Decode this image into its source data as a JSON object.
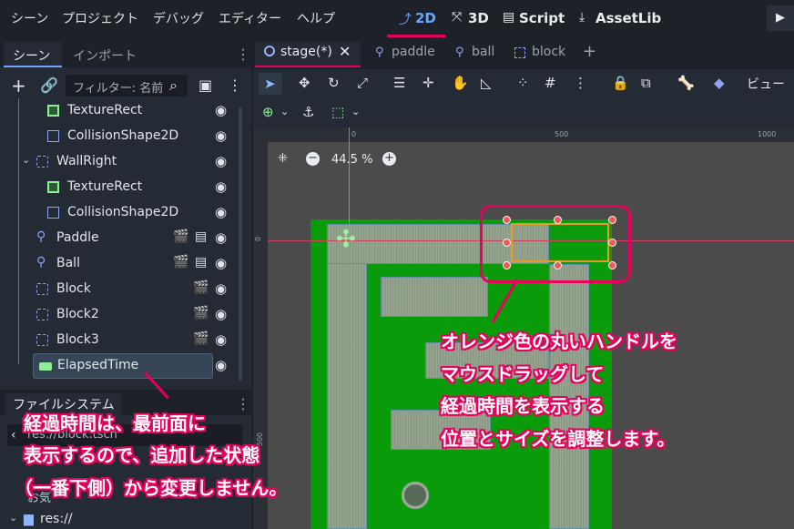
{
  "menubar": {
    "items": [
      "シーン",
      "プロジェクト",
      "デバッグ",
      "エディター",
      "ヘルプ"
    ],
    "workspaces": [
      {
        "label": "2D",
        "icon": "2d-workspace-icon",
        "active": true
      },
      {
        "label": "3D",
        "icon": "3d-workspace-icon",
        "active": false
      },
      {
        "label": "Script",
        "icon": "script-icon",
        "active": false
      },
      {
        "label": "AssetLib",
        "icon": "download-icon",
        "active": false
      }
    ],
    "play_icon": "▶"
  },
  "scene_dock": {
    "tabs": [
      "シーン",
      "インポート"
    ],
    "filter_placeholder": "フィルター: 名前",
    "tree": [
      {
        "label": "TextureRect",
        "icon": "texture-rect-icon"
      },
      {
        "label": "CollisionShape2D",
        "icon": "collision-shape-icon"
      },
      {
        "label": "WallRight",
        "icon": "node2d-icon",
        "expanded": true
      },
      {
        "label": "TextureRect",
        "icon": "texture-rect-icon"
      },
      {
        "label": "CollisionShape2D",
        "icon": "collision-shape-icon"
      },
      {
        "label": "Paddle",
        "icon": "character-body-icon"
      },
      {
        "label": "Ball",
        "icon": "character-body-icon"
      },
      {
        "label": "Block",
        "icon": "node2d-icon"
      },
      {
        "label": "Block2",
        "icon": "node2d-icon"
      },
      {
        "label": "Block3",
        "icon": "node2d-icon"
      },
      {
        "label": "ElapsedTime",
        "icon": "label-icon",
        "selected": true
      }
    ]
  },
  "filesystem_dock": {
    "tab": "ファイルシステム",
    "path": "res://block.tscn",
    "favorites_label": "お気",
    "root": "res://"
  },
  "editor": {
    "tabs": [
      {
        "label": "stage(*)",
        "active": true
      },
      {
        "label": "paddle",
        "active": false
      },
      {
        "label": "ball",
        "active": false
      },
      {
        "label": "block",
        "active": false
      }
    ],
    "add_tab": "+",
    "view_menu": "ビュー",
    "zoom": "44.5 %",
    "ruler": {
      "top": [
        "0",
        "500",
        "1000"
      ],
      "left": [
        "0",
        "500"
      ]
    }
  },
  "annotations": {
    "right": [
      "オレンジ色の丸いハンドルを",
      "マウスドラッグして",
      "経過時間を表示する",
      "位置とサイズを調整します。"
    ],
    "left": [
      "経過時間は、最前面に",
      "表示するので、追加した状態",
      "（一番下側）から変更しません。"
    ]
  },
  "colors": {
    "accent": "#e4005a",
    "workspace_active": "#6ca4ff",
    "stage_green": "#0a9b0a",
    "selection_orange": "#e99a25"
  }
}
